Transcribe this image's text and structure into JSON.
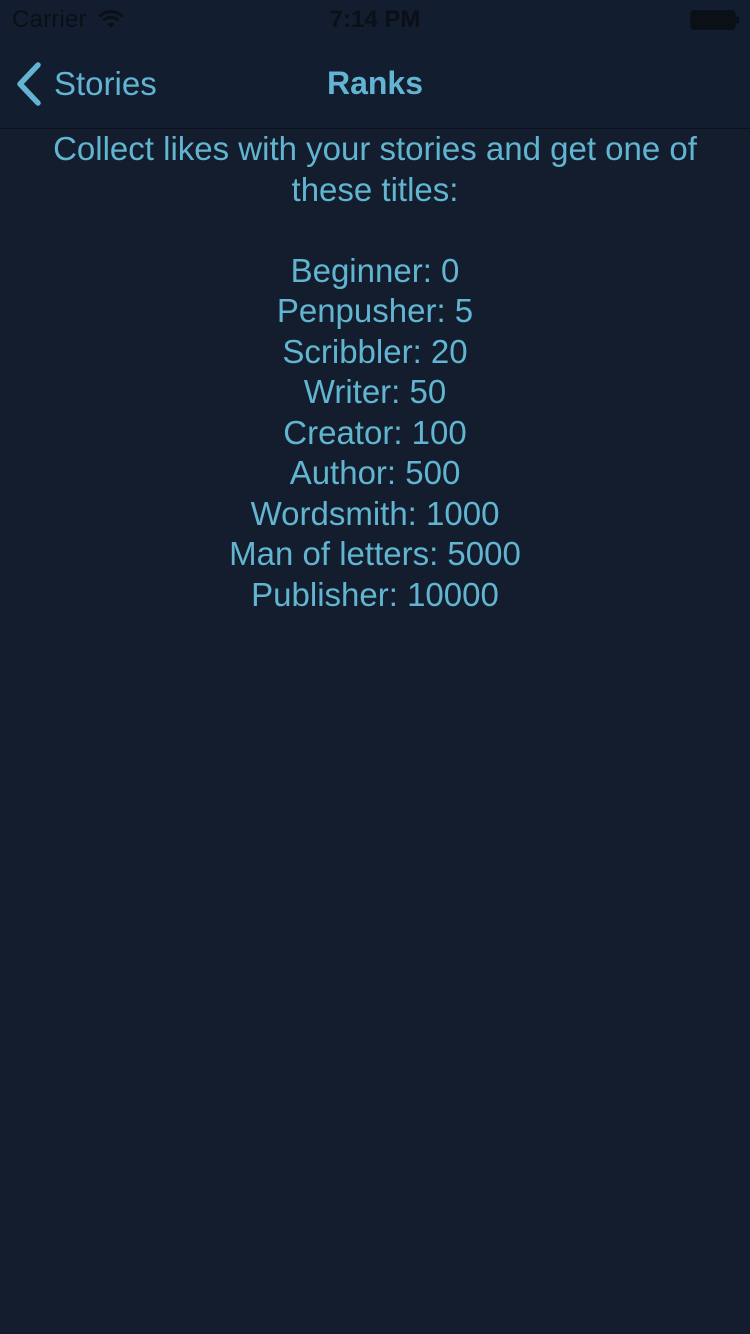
{
  "status_bar": {
    "carrier": "Carrier",
    "time": "7:14 PM",
    "wifi_icon": "wifi-icon",
    "battery_icon": "battery-icon"
  },
  "nav": {
    "back_label": "Stories",
    "back_icon": "chevron-left-icon",
    "title": "Ranks"
  },
  "content": {
    "intro": "Collect likes with your stories and get one of these titles:",
    "ranks": [
      "Beginner: 0",
      "Penpusher: 5",
      "Scribbler: 20",
      "Writer: 50",
      "Creator: 100",
      "Author: 500",
      "Wordsmith: 1000",
      "Man of letters: 5000",
      "Publisher: 10000"
    ]
  },
  "colors": {
    "background": "#131d2e",
    "accent": "#63b4d3"
  }
}
